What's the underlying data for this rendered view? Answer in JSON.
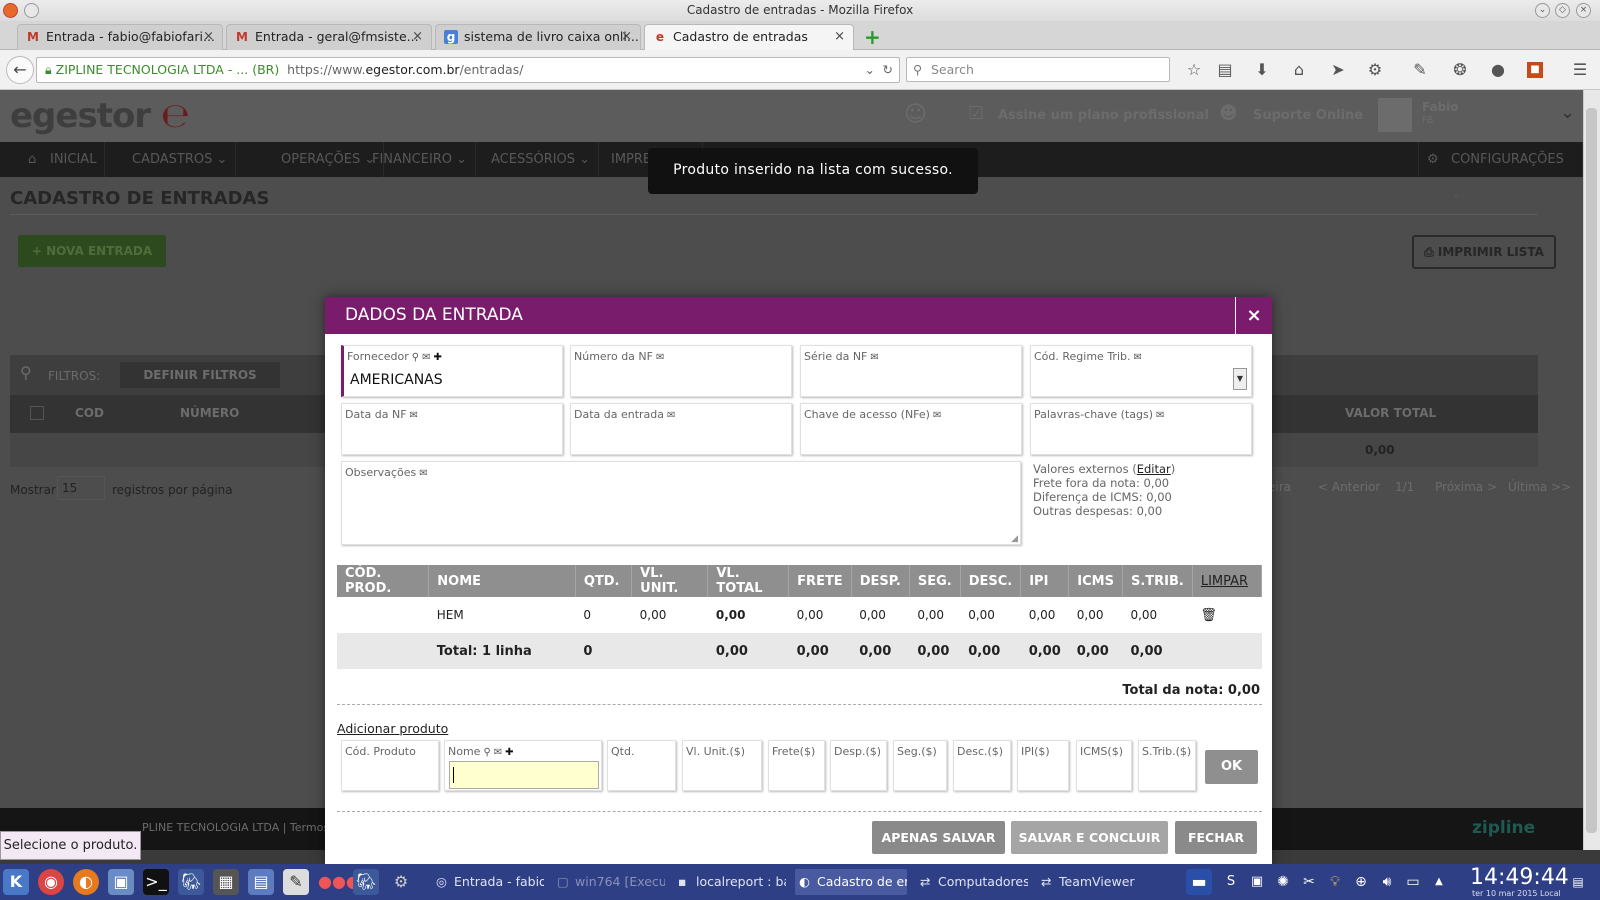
{
  "window": {
    "title": "Cadastro de entradas - Mozilla Firefox"
  },
  "tabs": [
    {
      "label": "Entrada - fabio@fabiofari...",
      "icon": "gmail-icon"
    },
    {
      "label": "Entrada - geral@fmsiste...",
      "icon": "gmail-icon"
    },
    {
      "label": "sistema de livro caixa onli...",
      "icon": "google-icon"
    },
    {
      "label": "Cadastro de entradas",
      "icon": "egestor-icon",
      "active": true
    }
  ],
  "nav": {
    "site_identity": "ZIPLINE TECNOLOGIA LTDA - ...",
    "country": "(BR)",
    "url_prefix": "https://www.",
    "url_domain": "egestor.com.br",
    "url_path": "/entradas/",
    "search_placeholder": "Search"
  },
  "app": {
    "logo": "egestor",
    "header_plan": "Assine um plano profissional",
    "header_support": "Suporte Online",
    "user_name": "Fabio",
    "user_sub": "FB",
    "menu": [
      "INICIAL",
      "CADASTROS",
      "OPERAÇÕES",
      "FINANCEIRO",
      "ACESSÓRIOS",
      "IMPRESSOES"
    ],
    "config": "CONFIGURAÇÕES",
    "page_title": "CADASTRO DE ENTRADAS",
    "new_button": "NOVA ENTRADA",
    "print_button": "IMPRIMIR LISTA",
    "filters_label": "FILTROS:",
    "filters_button": "DEFINIR FILTROS",
    "list_headers": [
      "COD",
      "NÚMERO",
      "VALOR TOTAL"
    ],
    "list_total": "0,00",
    "show_label": "Mostrar",
    "per_page": "15",
    "per_page_suffix": "registros por página",
    "pagination": [
      "eira",
      "< Anterior",
      "1/1",
      "Próxima >",
      "Última >>"
    ],
    "footer": "PLINE TECNOLOGIA LTDA | Termos de",
    "footer_brand": "zipline"
  },
  "toast": "Produto inserido na lista com sucesso.",
  "tooltip": "Selecione o produto.",
  "modal": {
    "title": "DADOS DA ENTRADA",
    "fields": {
      "fornecedor": {
        "label": "Fornecedor",
        "value": "AMERICANAS"
      },
      "numero_nf": {
        "label": "Número da NF",
        "value": ""
      },
      "serie_nf": {
        "label": "Série da NF",
        "value": ""
      },
      "cod_regime": {
        "label": "Cód. Regime Trib.",
        "value": ""
      },
      "data_nf": {
        "label": "Data da NF",
        "value": ""
      },
      "data_entrada": {
        "label": "Data da entrada",
        "value": ""
      },
      "chave": {
        "label": "Chave de acesso (NFe)",
        "value": ""
      },
      "tags": {
        "label": "Palavras-chave (tags)",
        "value": ""
      },
      "obs": {
        "label": "Observações",
        "value": ""
      }
    },
    "external": {
      "title": "Valores externos (",
      "edit": "Editar",
      "close": ")",
      "frete": "Frete fora da nota: 0,00",
      "icms": "Diferença de ICMS: 0,00",
      "outras": "Outras despesas: 0,00"
    },
    "table": {
      "headers": [
        "CÓD. PROD.",
        "NOME",
        "QTD.",
        "VL. UNIT.",
        "VL. TOTAL",
        "FRETE",
        "DESP.",
        "SEG.",
        "DESC.",
        "IPI",
        "ICMS",
        "S.TRIB."
      ],
      "clear": "LIMPAR",
      "row": [
        "",
        "HEM",
        "0",
        "0,00",
        "0,00",
        "0,00",
        "0,00",
        "0,00",
        "0,00",
        "0,00",
        "0,00",
        "0,00"
      ],
      "total_row": [
        "",
        "Total: 1 linha",
        "0",
        "",
        "0,00",
        "0,00",
        "0,00",
        "0,00",
        "0,00",
        "0,00",
        "0,00",
        "0,00"
      ]
    },
    "total_nota": "Total da nota: 0,00",
    "add_product": "Adicionar produto",
    "add_fields": [
      "Cód. Produto",
      "Nome",
      "Qtd.",
      "Vl. Unit.($)",
      "Frete($)",
      "Desp.($)",
      "Seg.($)",
      "Desc.($)",
      "IPI($)",
      "ICMS($)",
      "S.Trib.($)"
    ],
    "ok": "OK",
    "buttons": {
      "save": "APENAS SALVAR",
      "save_close": "SALVAR E CONCLUIR",
      "close": "FECHAR"
    }
  },
  "taskbar": {
    "apps": [
      "Entrada - fabio",
      "win764 [Execu",
      "localreport : ba",
      "Cadastro de en",
      "Computadores",
      "TeamViewer"
    ],
    "time": "14:49:44",
    "date": "ter 10 mar 2015 Local"
  }
}
